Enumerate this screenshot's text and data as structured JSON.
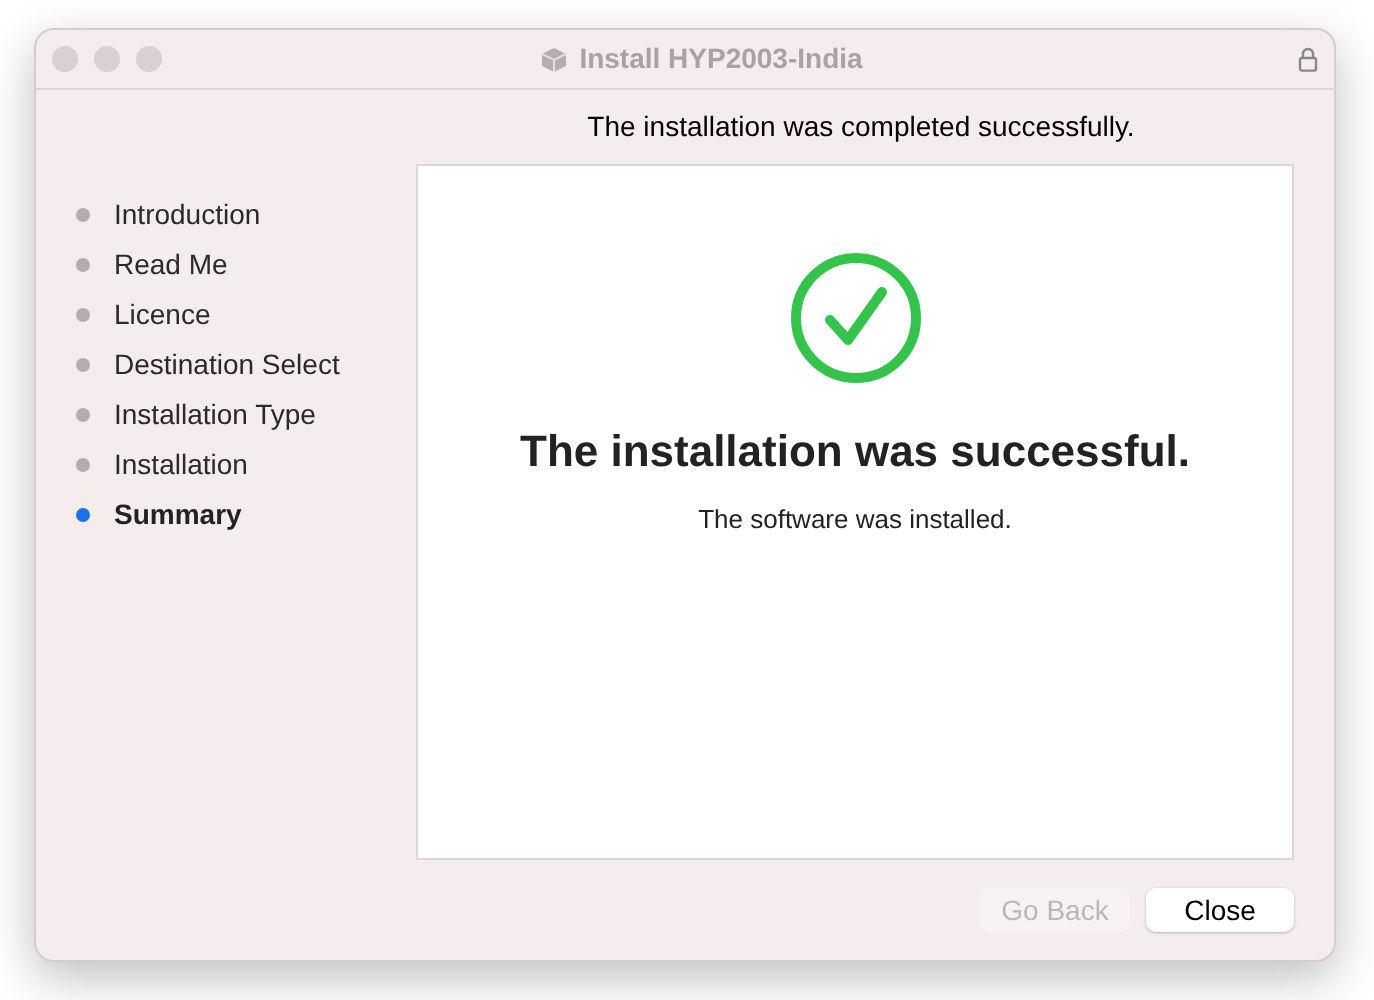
{
  "window": {
    "title": "Install HYP2003-India"
  },
  "header": "The installation was completed successfully.",
  "steps": [
    {
      "label": "Introduction",
      "selected": false
    },
    {
      "label": "Read Me",
      "selected": false
    },
    {
      "label": "Licence",
      "selected": false
    },
    {
      "label": "Destination Select",
      "selected": false
    },
    {
      "label": "Installation Type",
      "selected": false
    },
    {
      "label": "Installation",
      "selected": false
    },
    {
      "label": "Summary",
      "selected": true
    }
  ],
  "result": {
    "title": "The installation was successful.",
    "message": "The software was installed."
  },
  "buttons": [
    {
      "label": "Go Back",
      "disabled": true
    },
    {
      "label": "Close",
      "disabled": false
    }
  ]
}
